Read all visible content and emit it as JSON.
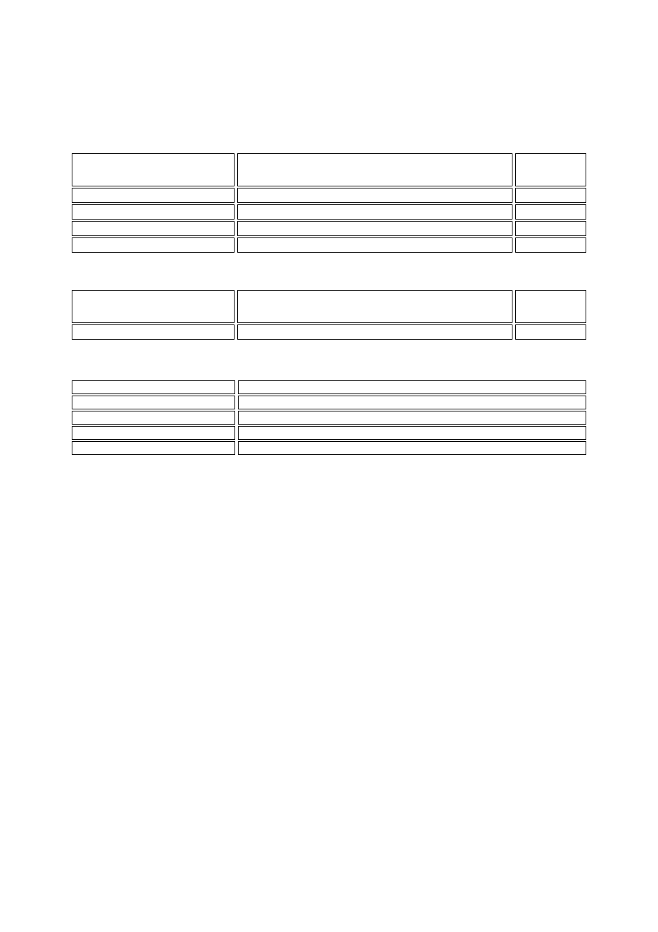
{
  "tables": {
    "t1": {
      "columns": 3,
      "rows": [
        {
          "cells": [
            "",
            "",
            ""
          ],
          "type": "header"
        },
        {
          "cells": [
            "",
            "",
            ""
          ],
          "type": "row"
        },
        {
          "cells": [
            "",
            "",
            ""
          ],
          "type": "row"
        },
        {
          "cells": [
            "",
            "",
            ""
          ],
          "type": "row"
        },
        {
          "cells": [
            "",
            "",
            ""
          ],
          "type": "row"
        }
      ]
    },
    "t2": {
      "columns": 3,
      "rows": [
        {
          "cells": [
            "",
            "",
            ""
          ],
          "type": "header"
        },
        {
          "cells": [
            "",
            "",
            ""
          ],
          "type": "row"
        }
      ]
    },
    "t3": {
      "columns": 2,
      "rows": [
        {
          "cells": [
            "",
            ""
          ],
          "type": "row"
        },
        {
          "cells": [
            "",
            ""
          ],
          "type": "row"
        },
        {
          "cells": [
            "",
            ""
          ],
          "type": "row"
        },
        {
          "cells": [
            "",
            ""
          ],
          "type": "row"
        },
        {
          "cells": [
            "",
            ""
          ],
          "type": "row"
        }
      ]
    }
  }
}
